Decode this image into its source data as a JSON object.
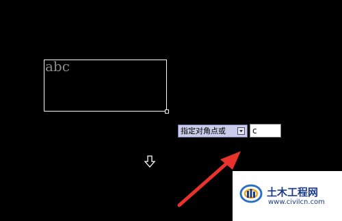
{
  "canvas": {
    "background": "#000000",
    "mtext": {
      "sample_text": "abc",
      "insert_icon": "down-arrow-icon"
    },
    "corner_grip_icon": "grip-square-icon"
  },
  "dynamic_input": {
    "prompt_label": "指定对角点或",
    "dropdown_icon": "dropdown-icon",
    "current_value": "c"
  },
  "annotation": {
    "arrow_color": "#e8322b",
    "icon": "red-arrow-icon"
  },
  "watermark": {
    "title": "土木工程网",
    "url": "www.civilcn.com",
    "logo": "civilcn-logo-icon"
  }
}
